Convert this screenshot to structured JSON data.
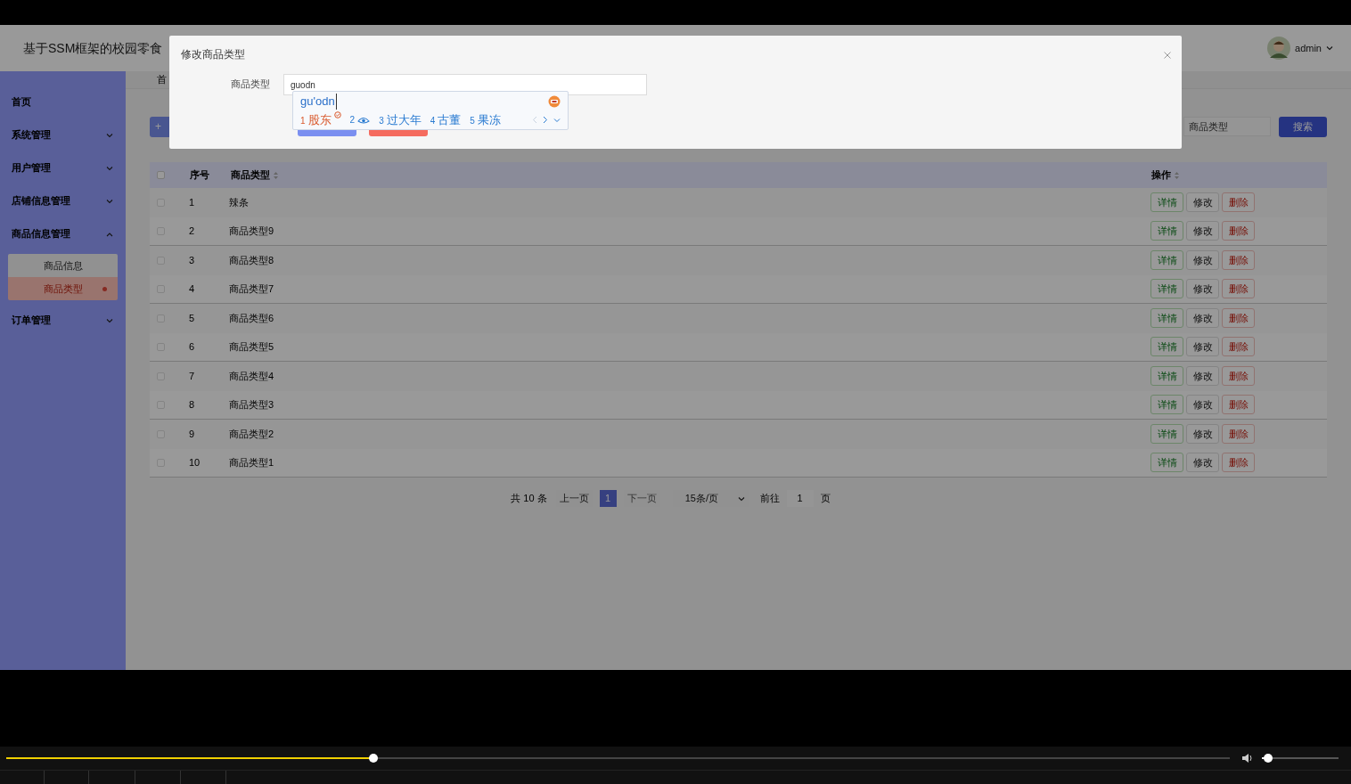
{
  "app": {
    "title": "基于SSM框架的校园零食",
    "user": "admin",
    "breadcrumb": "首"
  },
  "sidebar": {
    "items": [
      {
        "label": "首页",
        "kind": "link"
      },
      {
        "label": "系统管理",
        "kind": "group",
        "expanded": false
      },
      {
        "label": "用户管理",
        "kind": "group",
        "expanded": false
      },
      {
        "label": "店铺信息管理",
        "kind": "group",
        "expanded": false
      },
      {
        "label": "商品信息管理",
        "kind": "group",
        "expanded": true,
        "children": [
          {
            "label": "商品信息",
            "selected": false
          },
          {
            "label": "商品类型",
            "selected": true
          }
        ]
      },
      {
        "label": "订单管理",
        "kind": "group",
        "expanded": false
      }
    ]
  },
  "toolbar": {
    "add_button": "+",
    "search": {
      "placeholder": "商品类型"
    },
    "search_button": "搜索"
  },
  "table": {
    "columns": [
      "序号",
      "商品类型",
      "操作"
    ],
    "all_checked": false,
    "rows": [
      {
        "index": "1",
        "type": "辣条",
        "checked": false,
        "actions": [
          {
            "label": "详情",
            "kind": "detail"
          },
          {
            "label": "修改",
            "kind": "edit"
          },
          {
            "label": "删除",
            "kind": "delete"
          }
        ]
      },
      {
        "index": "2",
        "type": "商品类型9",
        "checked": false,
        "actions": [
          {
            "label": "详情",
            "kind": "detail"
          },
          {
            "label": "修改",
            "kind": "edit"
          },
          {
            "label": "删除",
            "kind": "delete"
          }
        ]
      },
      {
        "index": "3",
        "type": "商品类型8",
        "checked": false,
        "actions": [
          {
            "label": "详情",
            "kind": "detail"
          },
          {
            "label": "修改",
            "kind": "edit"
          },
          {
            "label": "删除",
            "kind": "delete"
          }
        ]
      },
      {
        "index": "4",
        "type": "商品类型7",
        "checked": false,
        "actions": [
          {
            "label": "详情",
            "kind": "detail"
          },
          {
            "label": "修改",
            "kind": "edit"
          },
          {
            "label": "删除",
            "kind": "delete"
          }
        ]
      },
      {
        "index": "5",
        "type": "商品类型6",
        "checked": false,
        "actions": [
          {
            "label": "详情",
            "kind": "detail"
          },
          {
            "label": "修改",
            "kind": "edit"
          },
          {
            "label": "删除",
            "kind": "delete"
          }
        ]
      },
      {
        "index": "6",
        "type": "商品类型5",
        "checked": false,
        "actions": [
          {
            "label": "详情",
            "kind": "detail"
          },
          {
            "label": "修改",
            "kind": "edit"
          },
          {
            "label": "删除",
            "kind": "delete"
          }
        ]
      },
      {
        "index": "7",
        "type": "商品类型4",
        "checked": false,
        "actions": [
          {
            "label": "详情",
            "kind": "detail"
          },
          {
            "label": "修改",
            "kind": "edit"
          },
          {
            "label": "删除",
            "kind": "delete"
          }
        ]
      },
      {
        "index": "8",
        "type": "商品类型3",
        "checked": false,
        "actions": [
          {
            "label": "详情",
            "kind": "detail"
          },
          {
            "label": "修改",
            "kind": "edit"
          },
          {
            "label": "删除",
            "kind": "delete"
          }
        ]
      },
      {
        "index": "9",
        "type": "商品类型2",
        "checked": false,
        "actions": [
          {
            "label": "详情",
            "kind": "detail"
          },
          {
            "label": "修改",
            "kind": "edit"
          },
          {
            "label": "删除",
            "kind": "delete"
          }
        ]
      },
      {
        "index": "10",
        "type": "商品类型1",
        "checked": false,
        "actions": [
          {
            "label": "详情",
            "kind": "detail"
          },
          {
            "label": "修改",
            "kind": "edit"
          },
          {
            "label": "删除",
            "kind": "delete"
          }
        ]
      }
    ]
  },
  "pagination": {
    "total": "共 10 条",
    "prev": "上一页",
    "pages": [
      {
        "label": "1",
        "selected": true
      }
    ],
    "next": "下一页",
    "page_size": "15条/页",
    "goto": "前往",
    "goto_value": "1",
    "page_unit": "页"
  },
  "modal": {
    "title": "修改商品类型",
    "field": {
      "label": "商品类型",
      "value": "guodn"
    },
    "buttons": [
      {
        "kind": "primary"
      },
      {
        "kind": "danger"
      }
    ]
  },
  "ime": {
    "composition": "gu'odn",
    "candidates": [
      {
        "number": "1",
        "text": "股东",
        "kind": "text",
        "selected": true
      },
      {
        "number": "2",
        "kind": "icon",
        "selected": false
      },
      {
        "number": "3",
        "text": "过大年",
        "kind": "text",
        "selected": false
      },
      {
        "number": "4",
        "text": "古董",
        "kind": "text",
        "selected": false
      },
      {
        "number": "5",
        "text": "果冻",
        "kind": "text",
        "selected": false
      }
    ]
  },
  "player": {
    "progress": {
      "level": 0.3
    },
    "volume": {
      "level": 0.08
    }
  }
}
